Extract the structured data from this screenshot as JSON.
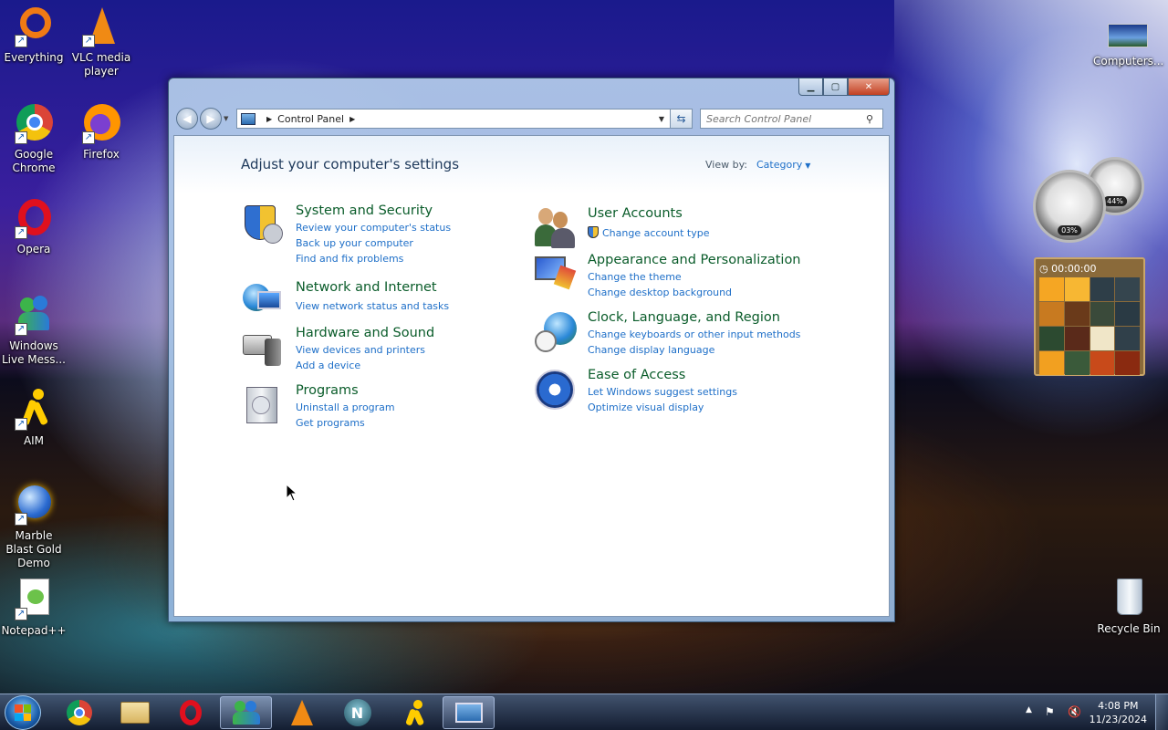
{
  "desktop": {
    "icons": [
      {
        "label": "Everything"
      },
      {
        "label": "VLC media player"
      },
      {
        "label": "Google Chrome"
      },
      {
        "label": "Firefox"
      },
      {
        "label": "Opera"
      },
      {
        "label": "Windows Live Mess..."
      },
      {
        "label": "AIM"
      },
      {
        "label": "Marble Blast Gold Demo"
      },
      {
        "label": "Notepad++"
      },
      {
        "label": "Computers..."
      },
      {
        "label": "Recycle Bin"
      }
    ]
  },
  "gadgets": {
    "cpu_percent": "03%",
    "memory_percent": "44%",
    "puzzle_timer": "00:00:00"
  },
  "window": {
    "address": {
      "crumb": "Control Panel"
    },
    "search": {
      "placeholder": "Search Control Panel"
    },
    "heading": "Adjust your computer's settings",
    "viewby": {
      "label": "View by:",
      "value": "Category"
    },
    "categories": [
      {
        "title": "System and Security",
        "links": [
          "Review your computer's status",
          "Back up your computer",
          "Find and fix problems"
        ]
      },
      {
        "title": "Network and Internet",
        "links": [
          "View network status and tasks"
        ]
      },
      {
        "title": "Hardware and Sound",
        "links": [
          "View devices and printers",
          "Add a device"
        ]
      },
      {
        "title": "Programs",
        "links": [
          "Uninstall a program",
          "Get programs"
        ]
      },
      {
        "title": "User Accounts",
        "links": [
          "Change account type"
        ]
      },
      {
        "title": "Appearance and Personalization",
        "links": [
          "Change the theme",
          "Change desktop background"
        ]
      },
      {
        "title": "Clock, Language, and Region",
        "links": [
          "Change keyboards or other input methods",
          "Change display language"
        ]
      },
      {
        "title": "Ease of Access",
        "links": [
          "Let Windows suggest settings",
          "Optimize visual display"
        ]
      }
    ]
  },
  "taskbar": {
    "clock": {
      "time": "4:08 PM",
      "date": "11/23/2024"
    }
  }
}
